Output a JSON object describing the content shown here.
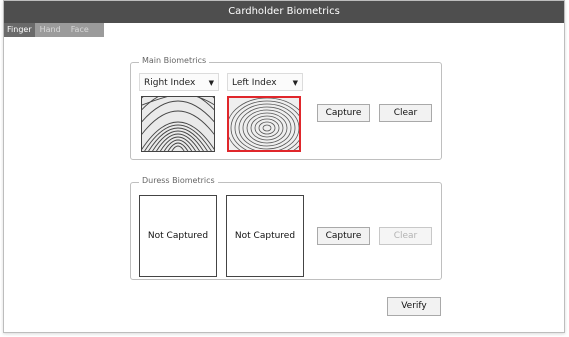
{
  "window": {
    "title": "Cardholder Biometrics"
  },
  "tabs": [
    {
      "label": "Finger",
      "active": true
    },
    {
      "label": "Hand",
      "active": false
    },
    {
      "label": "Face",
      "active": false
    }
  ],
  "main_biometrics": {
    "label": "Main Biometrics",
    "left_select": "Right Index",
    "right_select": "Left Index",
    "capture_label": "Capture",
    "clear_label": "Clear",
    "selected_finger": "right"
  },
  "duress_biometrics": {
    "label": "Duress Biometrics",
    "left_status": "Not Captured",
    "right_status": "Not Captured",
    "capture_label": "Capture",
    "clear_label": "Clear",
    "clear_enabled": false
  },
  "verify_label": "Verify",
  "colors": {
    "titlebar": "#4e4e4e",
    "selection_border": "#e0262b"
  }
}
